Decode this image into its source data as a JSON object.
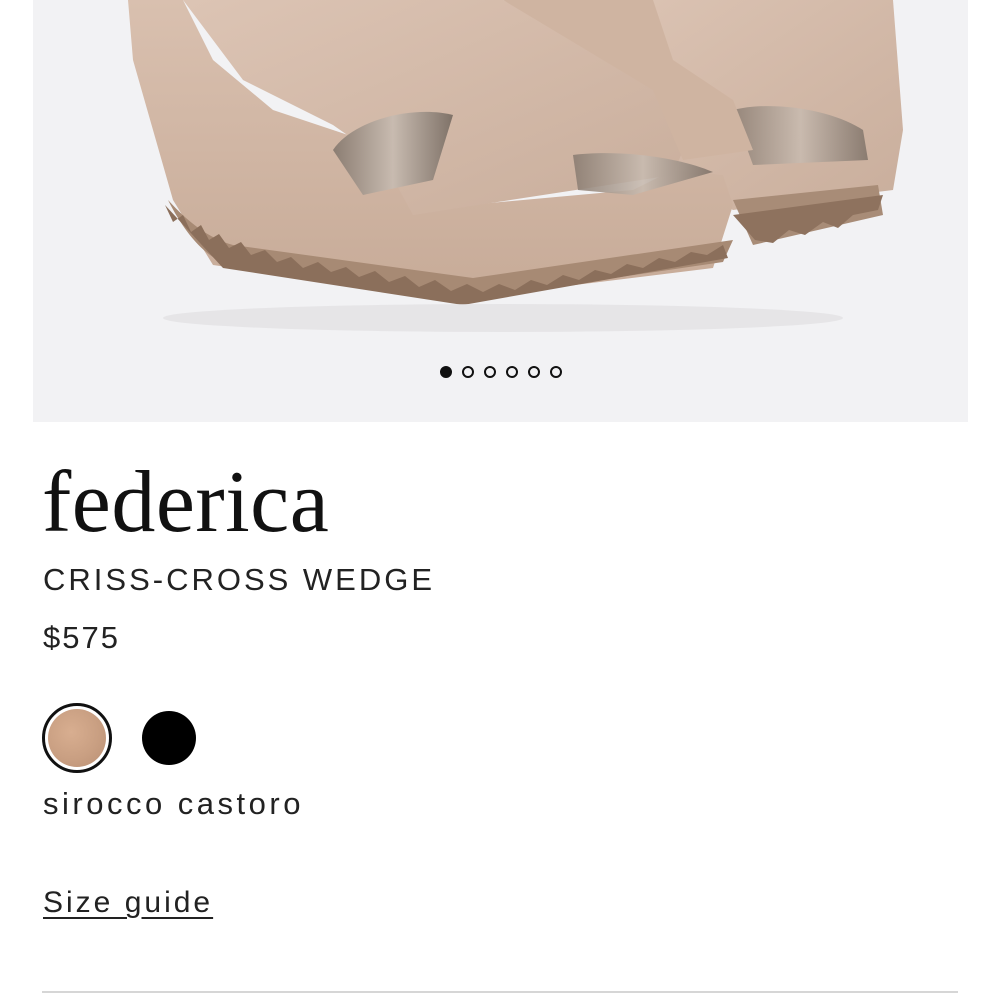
{
  "product": {
    "name": "federica",
    "style": "CRISS-CROSS WEDGE",
    "price": "$575",
    "image_alt": "sandal-product-image"
  },
  "gallery": {
    "slide_count": 6,
    "active_slide": 1
  },
  "colors": {
    "options": [
      {
        "name": "sirocco castoro",
        "hex": "#c9a083",
        "selected": true
      },
      {
        "name": "black",
        "hex": "#000000",
        "selected": false
      }
    ],
    "selected_label": "sirocco castoro"
  },
  "links": {
    "size_guide": "Size guide"
  },
  "theme": {
    "gallery_bg": "#f2f2f4",
    "suede": "#d5bcab",
    "sole": "#9b7f6a"
  }
}
